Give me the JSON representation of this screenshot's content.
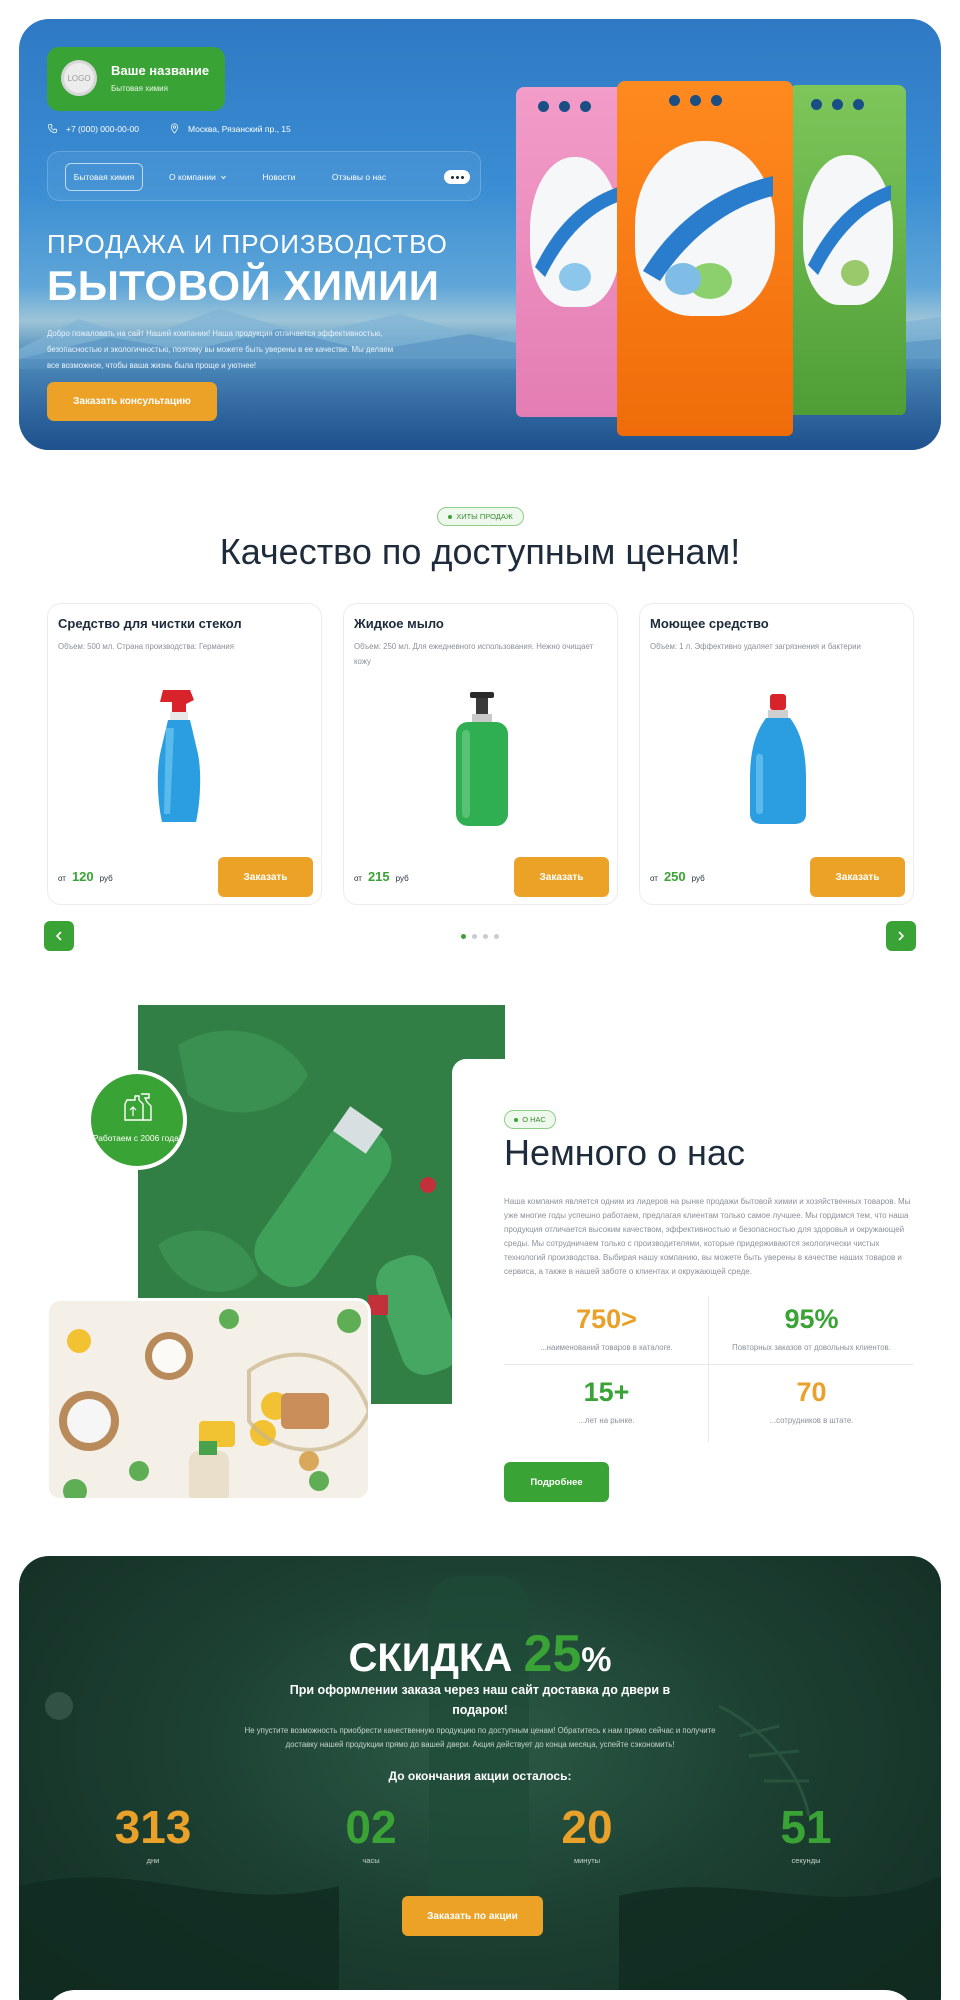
{
  "hero": {
    "brand_name": "Ваше название",
    "brand_sub": "Бытовая химия",
    "logo_text": "LOGO",
    "phone": "+7 (000) 000-00-00",
    "address": "Москва, Рязанский пр., 15",
    "nav": [
      {
        "label": "Бытовая химия",
        "active": true
      },
      {
        "label": "О компании",
        "dropdown": true
      },
      {
        "label": "Новости"
      },
      {
        "label": "Отзывы о нас"
      }
    ],
    "subtitle": "ПРОДАЖА И ПРОИЗВОДСТВО",
    "title": "БЫТОВОЙ ХИМИИ",
    "description": "Добро пожаловать на сайт Нашей компании! Наша продукция отличается эффективностью, безопасностью и экологичностью, поэтому вы можете быть уверены в ее качестве. Мы делаем все возможное, чтобы ваша жизнь была проще и уютнее!",
    "cta": "Заказать консультацию"
  },
  "hits": {
    "pill": "ХИТЫ ПРОДАЖ",
    "title": "Качество по доступным ценам!",
    "products": [
      {
        "title": "Средство для чистки стекол",
        "desc": "Объем: 500 мл. Страна производства: Германия",
        "price_prefix": "от",
        "price": "120",
        "currency": "руб",
        "button": "Заказать"
      },
      {
        "title": "Жидкое мыло",
        "desc": "Объем: 250 мл. Для ежедневного использования. Нежно очищает кожу",
        "price_prefix": "от",
        "price": "215",
        "currency": "руб",
        "button": "Заказать"
      },
      {
        "title": "Моющее средство",
        "desc": "Объем: 1 л. Эффективно удаляет загрязнения и бактерии",
        "price_prefix": "от",
        "price": "250",
        "currency": "руб",
        "button": "Заказать"
      }
    ],
    "slider_pages": 4,
    "slider_active": 1
  },
  "about": {
    "badge": "Работаем с 2006 года!",
    "pill": "О НАС",
    "title": "Немного о нас",
    "text": "Наша компания является одним из лидеров на рынке продажи бытовой химии и хозяйственных товаров. Мы уже многие годы успешно работаем, предлагая клиентам только самое лучшее. Мы гордимся тем, что наша продукция отличается высоким качеством, эффективностью и безопасностью для здоровья и окружающей среды. Мы сотрудничаем только с производителями, которые придерживаются экологически чистых технологий производства. Выбирая нашу компанию, вы можете быть уверены в качестве наших товаров и сервиса, а также в нашей заботе о клиентах и окружающей среде.",
    "stats": [
      {
        "value": "750>",
        "label": "...наименований товаров в каталоге.",
        "color": "#e9a12a"
      },
      {
        "value": "95%",
        "label": "Повторных заказов от довольных клиентов.",
        "color": "#3aa335"
      },
      {
        "value": "15+",
        "label": "...лет на рынке.",
        "color": "#3aa335"
      },
      {
        "value": "70",
        "label": "...сотрудников в штате.",
        "color": "#e9a12a"
      }
    ],
    "button": "Подробнее"
  },
  "promo": {
    "head_word": "СКИДКА",
    "head_num": "25",
    "head_pct": "%",
    "subtitle": "При оформлении заказа через наш сайт доставка до двери в подарок!",
    "description": "Не упустите возможность приобрести качественную продукцию по доступным ценам! Обратитесь к нам прямо сейчас и получите доставку нашей продукции прямо до вашей двери. Акция действует до конца месяца, успейте сэкономить!",
    "until": "До окончания акции осталось:",
    "countdown": [
      {
        "value": "313",
        "unit": "дни",
        "color": "#e9a12a"
      },
      {
        "value": "02",
        "unit": "часы",
        "color": "#3aa335"
      },
      {
        "value": "20",
        "unit": "минуты",
        "color": "#e9a12a"
      },
      {
        "value": "51",
        "unit": "секунды",
        "color": "#3aa335"
      }
    ],
    "button": "Заказать по акции"
  },
  "colors": {
    "green": "#3aa335",
    "orange": "#eba227",
    "dark": "#1d2b3a"
  }
}
